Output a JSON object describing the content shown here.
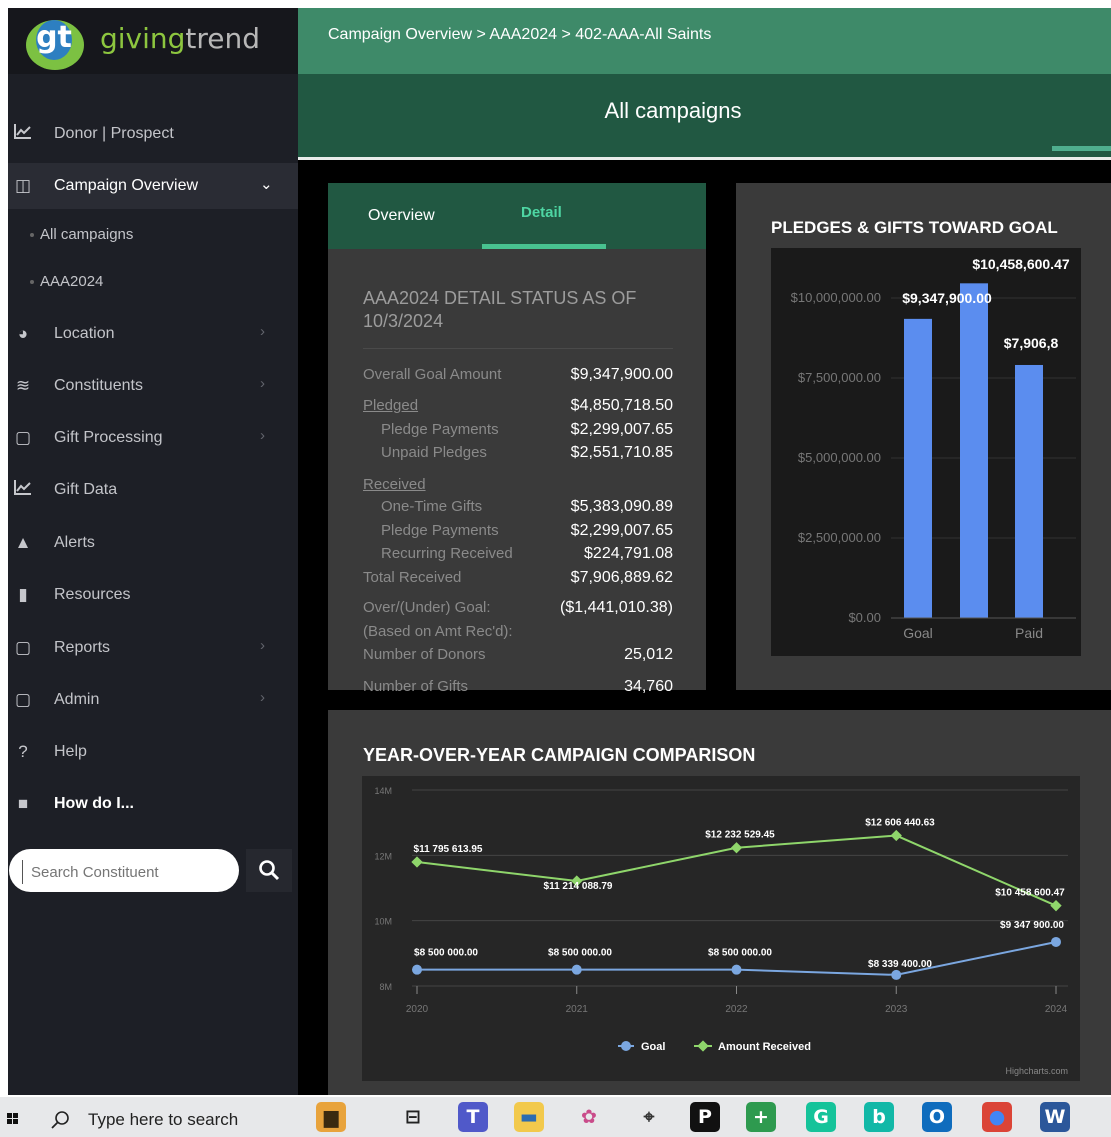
{
  "app": {
    "logo_mark": "gt",
    "logo_word1": "giving",
    "logo_word2": "trend"
  },
  "sidebar": {
    "items": [
      {
        "label": "Donor | Prospect",
        "icon": "line-chart-icon"
      },
      {
        "label": "Campaign Overview",
        "icon": "table-icon"
      },
      {
        "label": "Location",
        "icon": "palette-icon"
      },
      {
        "label": "Constituents",
        "icon": "layers-icon"
      },
      {
        "label": "Gift Processing",
        "icon": "note-icon"
      },
      {
        "label": "Gift Data",
        "icon": "line-chart-icon"
      },
      {
        "label": "Alerts",
        "icon": "warning-icon"
      },
      {
        "label": "Resources",
        "icon": "book-icon"
      },
      {
        "label": "Reports",
        "icon": "note-icon"
      },
      {
        "label": "Admin",
        "icon": "note-icon"
      },
      {
        "label": "Help",
        "icon": "question-icon"
      },
      {
        "label": "How do I...",
        "icon": "video-icon"
      }
    ],
    "sub_items": [
      "All campaigns",
      "AAA2024"
    ],
    "search_placeholder": "Search Constituent",
    "chevron_down": "⌄",
    "chevron_right": "›"
  },
  "header": {
    "breadcrumb": "Campaign Overview > AAA2024 > 402-AAA-All Saints",
    "title": "All campaigns"
  },
  "detail": {
    "tabs": [
      "Overview",
      "Detail"
    ],
    "active_tab": "Detail",
    "heading": "AAA2024 DETAIL STATUS AS OF 10/3/2024",
    "rows": [
      {
        "label": "Overall Goal Amount",
        "value": "$9,347,900.00"
      },
      {
        "label": "Pledged",
        "value": "$4,850,718.50"
      },
      {
        "label": "Pledge Payments",
        "value": "$2,299,007.65"
      },
      {
        "label": "Unpaid Pledges",
        "value": "$2,551,710.85"
      },
      {
        "label": "Received",
        "value": ""
      },
      {
        "label": "One-Time Gifts",
        "value": "$5,383,090.89"
      },
      {
        "label": "Pledge Payments",
        "value": "$2,299,007.65"
      },
      {
        "label": "Recurring Received",
        "value": "$224,791.08"
      },
      {
        "label": "Total Received",
        "value": "$7,906,889.62"
      },
      {
        "label": "Over/(Under) Goal:",
        "value": "($1,441,010.38)"
      },
      {
        "label": "(Based on Amt Rec'd):",
        "value": ""
      },
      {
        "label": "Number of Donors",
        "value": "25,012"
      },
      {
        "label": "Number of Gifts",
        "value": "34,760"
      }
    ]
  },
  "colors": {
    "accent_green": "#3e8a69",
    "bar_blue": "#5b8def",
    "goal_line": "#7ba7e0",
    "received_line": "#8fd66b"
  },
  "taskbar": {
    "search_placeholder": "Type here to search",
    "icons": [
      "start-icon",
      "search-icon",
      "briefcase-icon",
      "task-view-icon",
      "teams-icon",
      "file-explorer-icon",
      "app-icon",
      "maps-icon",
      "parking-icon",
      "plus-app-icon",
      "grammarly-icon",
      "bing-icon",
      "outlook-icon",
      "chrome-icon",
      "word-icon"
    ]
  },
  "chart_data": [
    {
      "type": "bar",
      "title": "PLEDGES & GIFTS TOWARD GOAL",
      "categories": [
        "Goal",
        "",
        "Paid"
      ],
      "values": [
        9347900.0,
        10458600.47,
        7906889.62
      ],
      "data_labels": [
        "$9,347,900.00",
        "$10,458,600.47",
        "$7,906,8"
      ],
      "y_ticks": [
        "$0.00",
        "$2,500,000.00",
        "$5,000,000.00",
        "$7,500,000.00",
        "$10,000,000.00"
      ],
      "ylim": [
        0,
        11000000
      ],
      "color": "#5b8def"
    },
    {
      "type": "line",
      "title": "YEAR-OVER-YEAR CAMPAIGN COMPARISON",
      "x": [
        "2020",
        "2021",
        "2022",
        "2023",
        "2024"
      ],
      "y_ticks": [
        "8M",
        "10M",
        "12M",
        "14M"
      ],
      "ylim": [
        8000000,
        14000000
      ],
      "series": [
        {
          "name": "Goal",
          "color": "#7ba7e0",
          "values": [
            8500000.0,
            8500000.0,
            8500000.0,
            8339400.0,
            9347900.0
          ],
          "labels": [
            "$8 500 000.00",
            "$8 500 000.00",
            "$8 500 000.00",
            "$8 339 400.00",
            "$9 347 900.00"
          ]
        },
        {
          "name": "Amount Received",
          "color": "#8fd66b",
          "values": [
            11795613.95,
            11214088.79,
            12232529.45,
            12606440.63,
            10458600.47
          ],
          "labels": [
            "$11 795 613.95",
            "$11 214 088.79",
            "$12 232 529.45",
            "$12 606 440.63",
            "$10 458 600.47"
          ]
        }
      ],
      "credit": "Highcharts.com"
    }
  ]
}
